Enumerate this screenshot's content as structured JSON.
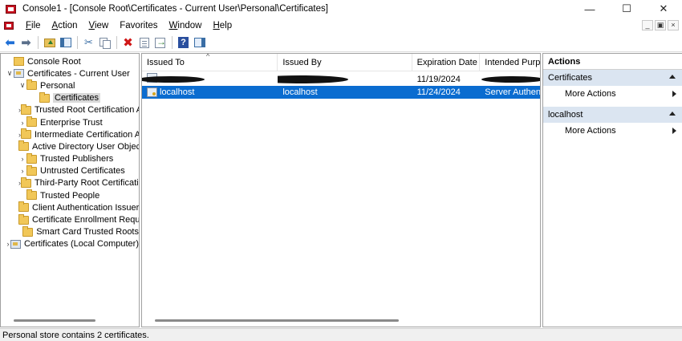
{
  "window": {
    "title": "Console1 - [Console Root\\Certificates - Current User\\Personal\\Certificates]",
    "minimize": "—",
    "maximize": "☐",
    "close": "✕"
  },
  "menu": {
    "items": [
      "File",
      "Action",
      "View",
      "Favorites",
      "Window",
      "Help"
    ],
    "underline": [
      "F",
      "A",
      "V",
      "",
      "W",
      "H"
    ]
  },
  "mdi": {
    "minimize": "_",
    "restore": "▣",
    "close": "×"
  },
  "tree": [
    {
      "label": "Console Root",
      "level": 0,
      "expander": "",
      "icon": "root-folder-icon"
    },
    {
      "label": "Certificates - Current User",
      "level": 0,
      "expander": "∨",
      "icon": "certificate-store-icon"
    },
    {
      "label": "Personal",
      "level": 1,
      "expander": "∨",
      "icon": "folder-icon"
    },
    {
      "label": "Certificates",
      "level": 2,
      "expander": "",
      "icon": "folder-icon",
      "selected": true
    },
    {
      "label": "Trusted Root Certification Authorities",
      "level": 1,
      "expander": "›",
      "icon": "folder-icon"
    },
    {
      "label": "Enterprise Trust",
      "level": 1,
      "expander": "›",
      "icon": "folder-icon"
    },
    {
      "label": "Intermediate Certification Authorities",
      "level": 1,
      "expander": "›",
      "icon": "folder-icon"
    },
    {
      "label": "Active Directory User Object",
      "level": 1,
      "expander": "",
      "icon": "folder-icon"
    },
    {
      "label": "Trusted Publishers",
      "level": 1,
      "expander": "›",
      "icon": "folder-icon"
    },
    {
      "label": "Untrusted Certificates",
      "level": 1,
      "expander": "›",
      "icon": "folder-icon"
    },
    {
      "label": "Third-Party Root Certification Authorities",
      "level": 1,
      "expander": "›",
      "icon": "folder-icon"
    },
    {
      "label": "Trusted People",
      "level": 1,
      "expander": "",
      "icon": "folder-icon"
    },
    {
      "label": "Client Authentication Issuers",
      "level": 1,
      "expander": "",
      "icon": "folder-icon"
    },
    {
      "label": "Certificate Enrollment Requests",
      "level": 1,
      "expander": "",
      "icon": "folder-icon"
    },
    {
      "label": "Smart Card Trusted Roots",
      "level": 1,
      "expander": "",
      "icon": "folder-icon"
    },
    {
      "label": "Certificates (Local Computer)",
      "level": 0,
      "expander": "›",
      "icon": "certificate-store-icon"
    }
  ],
  "list": {
    "columns": [
      "Issued To",
      "Issued By",
      "Expiration Date",
      "Intended Purposes"
    ],
    "sort_indicator": "^",
    "rows": [
      {
        "issued_to": "",
        "issued_by": "",
        "expiration": "11/19/2024",
        "purposes": "",
        "redacted": true
      },
      {
        "issued_to": "localhost",
        "issued_by": "localhost",
        "expiration": "11/24/2024",
        "purposes": "Server Authentication",
        "selected": true
      }
    ]
  },
  "actions": {
    "title": "Actions",
    "sections": [
      {
        "label": "Certificates",
        "items": [
          "More Actions"
        ]
      },
      {
        "label": "localhost",
        "items": [
          "More Actions"
        ]
      }
    ]
  },
  "status": {
    "text": "Personal store contains 2 certificates."
  }
}
